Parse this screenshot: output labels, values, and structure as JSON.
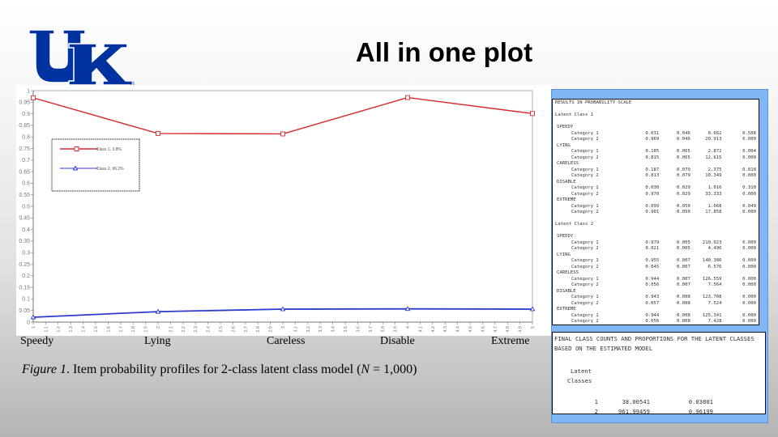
{
  "slide": {
    "title": "All in one plot",
    "logo_alt": "UK logo",
    "logo_mark": "®",
    "caption": {
      "figure_label": "Figure 1",
      "text_before_n": ". Item probability profiles for 2-class latent class model (",
      "n_symbol": "N",
      "text_after_n": " = 1,000)"
    }
  },
  "colors": {
    "uk_blue": "#0033a0",
    "class1_line": "#d62a2a",
    "class2_line": "#2b3bcc",
    "results_frame": "#7fb6f3"
  },
  "chart_data": {
    "type": "line",
    "title": "",
    "xlabel": "",
    "ylabel": "",
    "xlim": [
      1,
      5
    ],
    "ylim": [
      0,
      1
    ],
    "x_ticks_step": 0.1,
    "y_ticks_step": 0.05,
    "y_tick_labels": [
      "0",
      "0.05",
      "0.1",
      "0.15",
      "0.2",
      "0.25",
      "0.3",
      "0.35",
      "0.4",
      "0.45",
      "0.5",
      "0.55",
      "0.6",
      "0.65",
      "0.7",
      "0.75",
      "0.8",
      "0.85",
      "0.9",
      "0.95",
      "1"
    ],
    "x": [
      1,
      2,
      3,
      4,
      5
    ],
    "categories": [
      "Speedy",
      "Lying",
      "Careless",
      "Disable",
      "Extreme"
    ],
    "legend_position": "upper-left",
    "grid": false,
    "series": [
      {
        "name": "Class 1, 3.8%",
        "marker": "square",
        "color": "#d62a2a",
        "values": [
          0.969,
          0.815,
          0.813,
          0.97,
          0.901
        ]
      },
      {
        "name": "Class 2, 96.2%",
        "marker": "triangle",
        "color": "#2b3bcc",
        "values": [
          0.021,
          0.045,
          0.056,
          0.057,
          0.056
        ]
      }
    ]
  },
  "results": {
    "heading": "RESULTS IN PROBABILITY SCALE",
    "classes": [
      {
        "label": "Latent Class 1",
        "items": [
          {
            "name": "SPEEDY",
            "rows": [
              [
                "Category 1",
                "0.031",
                "0.046",
                "0.662",
                "0.508"
              ],
              [
                "Category 2",
                "0.969",
                "0.046",
                "20.913",
                "0.000"
              ]
            ]
          },
          {
            "name": "LYING",
            "rows": [
              [
                "Category 1",
                "0.185",
                "0.065",
                "2.872",
                "0.004"
              ],
              [
                "Category 2",
                "0.815",
                "0.065",
                "12.615",
                "0.000"
              ]
            ]
          },
          {
            "name": "CARELESS",
            "rows": [
              [
                "Category 1",
                "0.187",
                "0.079",
                "2.375",
                "0.018"
              ],
              [
                "Category 2",
                "0.813",
                "0.079",
                "10.349",
                "0.000"
              ]
            ]
          },
          {
            "name": "DISABLE",
            "rows": [
              [
                "Category 1",
                "0.030",
                "0.029",
                "1.016",
                "0.310"
              ],
              [
                "Category 2",
                "0.970",
                "0.029",
                "33.333",
                "0.000"
              ]
            ]
          },
          {
            "name": "EXTREME",
            "rows": [
              [
                "Category 1",
                "0.099",
                "0.050",
                "1.668",
                "0.049"
              ],
              [
                "Category 2",
                "0.901",
                "0.050",
                "17.858",
                "0.000"
              ]
            ]
          }
        ]
      },
      {
        "label": "Latent Class 2",
        "items": [
          {
            "name": "SPEEDY",
            "rows": [
              [
                "Category 1",
                "0.979",
                "0.005",
                "210.023",
                "0.000"
              ],
              [
                "Category 2",
                "0.021",
                "0.005",
                "4.496",
                "0.000"
              ]
            ]
          },
          {
            "name": "LYING",
            "rows": [
              [
                "Category 1",
                "0.955",
                "0.007",
                "140.386",
                "0.000"
              ],
              [
                "Category 2",
                "0.045",
                "0.007",
                "6.576",
                "0.000"
              ]
            ]
          },
          {
            "name": "CARELESS",
            "rows": [
              [
                "Category 1",
                "0.944",
                "0.007",
                "126.559",
                "0.000"
              ],
              [
                "Category 2",
                "0.056",
                "0.007",
                "7.564",
                "0.000"
              ]
            ]
          },
          {
            "name": "DISABLE",
            "rows": [
              [
                "Category 1",
                "0.943",
                "0.008",
                "123.708",
                "0.000"
              ],
              [
                "Category 2",
                "0.057",
                "0.008",
                "7.524",
                "0.000"
              ]
            ]
          },
          {
            "name": "EXTREME",
            "rows": [
              [
                "Category 1",
                "0.944",
                "0.008",
                "125.341",
                "0.000"
              ],
              [
                "Category 2",
                "0.056",
                "0.008",
                "7.428",
                "0.000"
              ]
            ]
          }
        ]
      }
    ]
  },
  "class_counts": {
    "heading_line1": "FINAL CLASS COUNTS AND PROPORTIONS FOR THE LATENT CLASSES",
    "heading_line2": "BASED ON THE ESTIMATED MODEL",
    "col_header_line1": "Latent",
    "col_header_line2": "Classes",
    "rows": [
      {
        "class": "1",
        "count": "38.00541",
        "proportion": "0.03801"
      },
      {
        "class": "2",
        "count": "961.99459",
        "proportion": "0.96199"
      }
    ]
  }
}
